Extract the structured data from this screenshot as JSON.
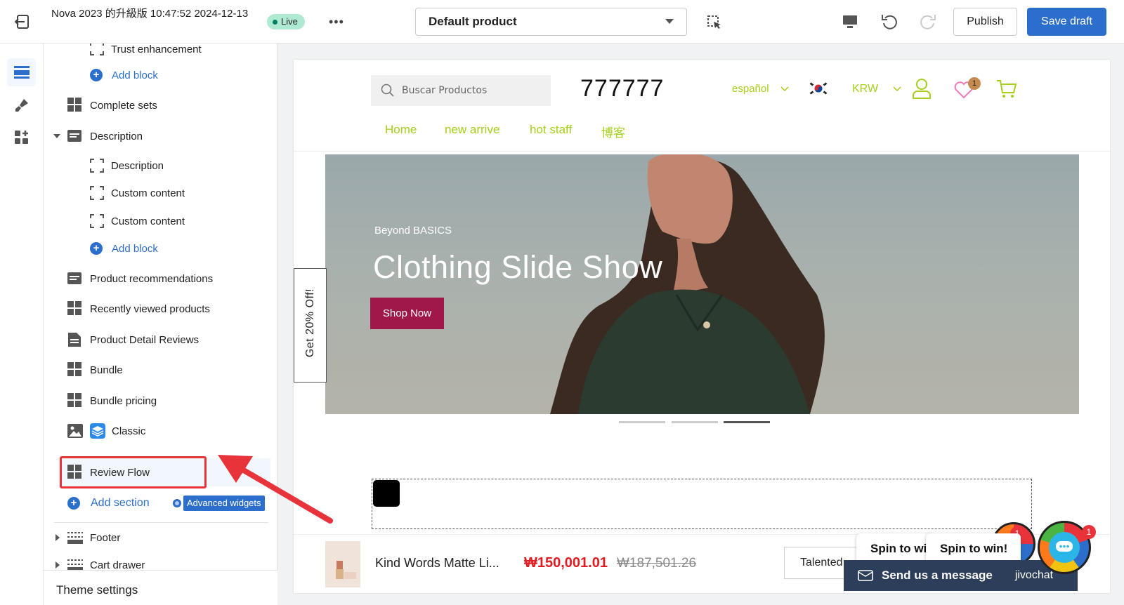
{
  "topbar": {
    "store_title": "Nova 2023 的升級版 10:47:52 2024-12-13",
    "live_label": "Live",
    "more_label": "•••",
    "template_select": "Default product",
    "publish_label": "Publish",
    "save_label": "Save draft"
  },
  "sidebar": {
    "items": [
      {
        "label": "Trust enhancement"
      },
      {
        "label": "Add block"
      },
      {
        "label": "Complete sets"
      },
      {
        "label": "Description"
      },
      {
        "label": "Description"
      },
      {
        "label": "Custom content"
      },
      {
        "label": "Custom content"
      },
      {
        "label": "Add block"
      },
      {
        "label": "Product recommendations"
      },
      {
        "label": "Recently viewed products"
      },
      {
        "label": "Product Detail Reviews"
      },
      {
        "label": "Bundle"
      },
      {
        "label": "Bundle pricing"
      },
      {
        "label": "Classic"
      },
      {
        "label": "Review Flow"
      },
      {
        "label": "Add section"
      },
      {
        "label": "Footer"
      },
      {
        "label": "Cart drawer"
      }
    ],
    "advanced_widgets": "Advanced widgets",
    "theme_settings": "Theme settings"
  },
  "preview": {
    "search_placeholder": "Buscar Productos",
    "logo": "777777",
    "language": "español",
    "currency": "KRW",
    "wishlist_count": "1",
    "nav": [
      "Home",
      "new arrive",
      "hot staff",
      "博客"
    ],
    "hero": {
      "subtitle": "Beyond BASICS",
      "title": "Clothing Slide Show",
      "button": "Shop Now"
    },
    "side_tab": "Get 20% Off!",
    "sticky": {
      "product_name": "Kind Words Matte Li...",
      "price": "₩150,001.01",
      "old_price": "₩187,501.26",
      "variant": "Talented"
    },
    "spin_1": "Spin to win!",
    "spin_2": "Spin to win!",
    "chat_message": "Send us a message",
    "chat_brand": "jivochat",
    "chat_badge": "1",
    "spin_badge": "1"
  }
}
